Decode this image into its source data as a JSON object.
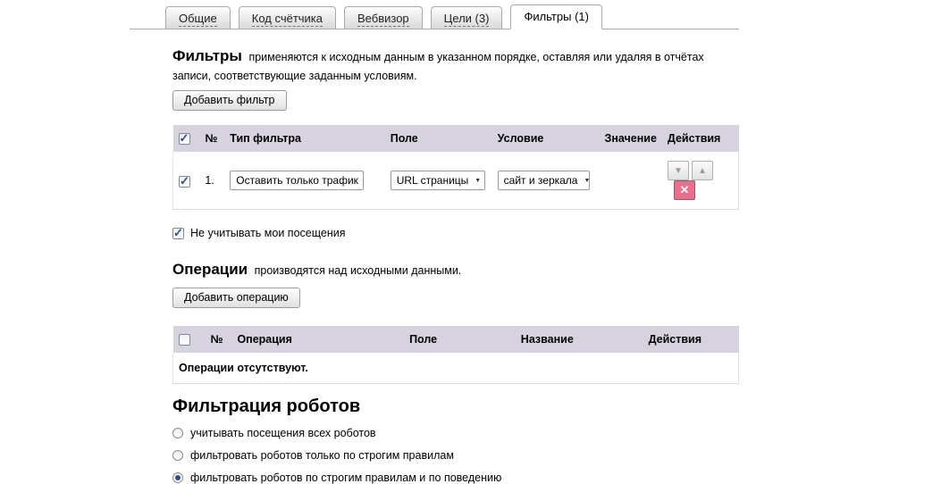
{
  "tabs": [
    {
      "label": "Общие",
      "active": false
    },
    {
      "label": "Код счётчика",
      "active": false
    },
    {
      "label": "Вебвизор",
      "active": false
    },
    {
      "label": "Цели (3)",
      "active": false
    },
    {
      "label": "Фильтры (1)",
      "active": true
    }
  ],
  "filters_section": {
    "title": "Фильтры",
    "description": "применяются к исходным данным в указанном порядке, оставляя или удаляя в отчётах записи, соответствующие заданным условиям.",
    "add_button": "Добавить фильтр",
    "table": {
      "select_all_checked": true,
      "headers": {
        "num": "№",
        "type": "Тип фильтра",
        "field": "Поле",
        "condition": "Условие",
        "value": "Значение",
        "actions": "Действия"
      },
      "rows": [
        {
          "checked": true,
          "num": "1.",
          "type": "Оставить только трафик",
          "field": "URL страницы",
          "condition": "сайт и зеркала",
          "value": ""
        }
      ]
    },
    "own_visits_checked": true,
    "own_visits_label": "Не учитывать мои посещения"
  },
  "operations_section": {
    "title": "Операции",
    "description": "производятся над исходными данными.",
    "add_button": "Добавить операцию",
    "table": {
      "select_all_checked": false,
      "headers": {
        "num": "№",
        "operation": "Операция",
        "field": "Поле",
        "name": "Название",
        "actions": "Действия"
      },
      "empty_text": "Операции отсутствуют."
    }
  },
  "robots_section": {
    "title": "Фильтрация роботов",
    "options": [
      {
        "label": "учитывать посещения всех роботов",
        "selected": false
      },
      {
        "label": "фильтровать роботов только по строгим правилам",
        "selected": false
      },
      {
        "label": "фильтровать роботов по строгим правилам и по поведению",
        "selected": true
      }
    ]
  },
  "icons": {
    "move_down": "▼",
    "move_up": "▲",
    "delete": "✕",
    "dropdown": "▼"
  },
  "colors": {
    "table_header_bg": "#d7d3de",
    "delete_button_bg": "#e96f8b",
    "tab_border": "#a9a9a9",
    "check_blue": "#2d4f8e"
  }
}
